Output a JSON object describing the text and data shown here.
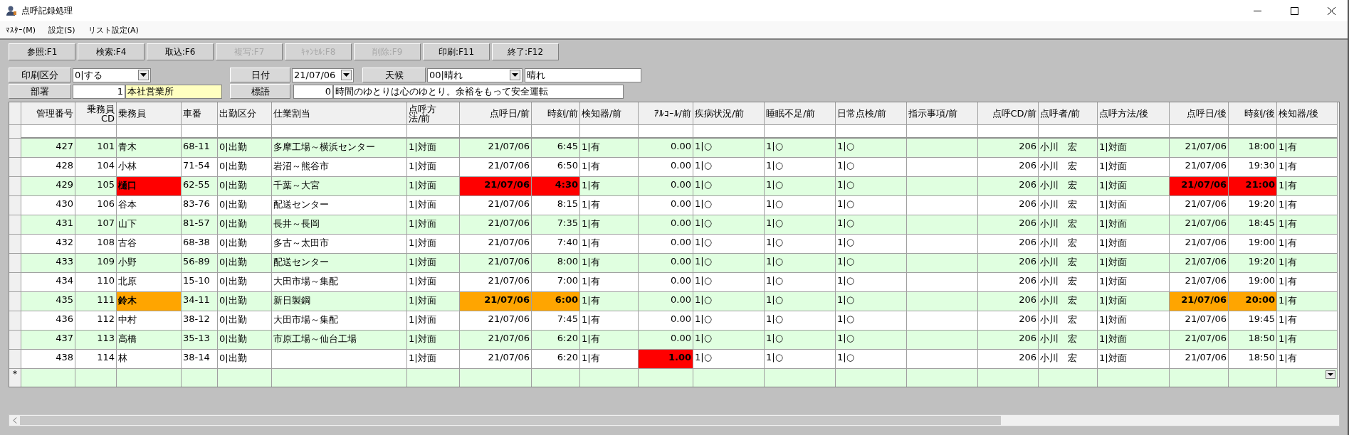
{
  "window": {
    "title": "点呼記録処理"
  },
  "menu": [
    "ﾏｽﾀｰ(M)",
    "設定(S)",
    "リスト設定(A)"
  ],
  "toolbar": [
    {
      "label": "参照:F1",
      "disabled": false
    },
    {
      "label": "検索:F4",
      "disabled": false
    },
    {
      "label": "取込:F6",
      "disabled": false
    },
    {
      "label": "複写:F7",
      "disabled": true
    },
    {
      "label": "ｷｬﾝｾﾙ:F8",
      "disabled": true
    },
    {
      "label": "削除:F9",
      "disabled": true
    },
    {
      "label": "印刷:F11",
      "disabled": false
    },
    {
      "label": "終了:F12",
      "disabled": false
    }
  ],
  "form": {
    "print_label": "印刷区分",
    "print_value": "0|する",
    "date_label": "日付",
    "date_value": "21/07/06",
    "weather_label": "天候",
    "weather_value": "00|晴れ",
    "weather_text": "晴れ",
    "dept_label": "部署",
    "dept_code": "1",
    "dept_name": "本社営業所",
    "motto_label": "標語",
    "motto_code": "0",
    "motto_text": "時間のゆとりは心のゆとり。余裕をもって安全運転"
  },
  "table": {
    "columns": [
      {
        "label": "管理番号",
        "kind": "num"
      },
      {
        "label": "乗務員CD",
        "kind": "num"
      },
      {
        "label": "乗務員",
        "kind": "text"
      },
      {
        "label": "車番",
        "kind": "text"
      },
      {
        "label": "出勤区分",
        "kind": "text"
      },
      {
        "label": "仕業割当",
        "kind": "text"
      },
      {
        "label": "点呼方法/前",
        "kind": "text"
      },
      {
        "label": "点呼日/前",
        "kind": "num"
      },
      {
        "label": "時刻/前",
        "kind": "num"
      },
      {
        "label": "検知器/前",
        "kind": "text"
      },
      {
        "label": "ｱﾙｺｰﾙ/前",
        "kind": "num"
      },
      {
        "label": "疾病状況/前",
        "kind": "text"
      },
      {
        "label": "睡眠不足/前",
        "kind": "text"
      },
      {
        "label": "日常点検/前",
        "kind": "text"
      },
      {
        "label": "指示事項/前",
        "kind": "text"
      },
      {
        "label": "点呼CD/前",
        "kind": "num"
      },
      {
        "label": "点呼者/前",
        "kind": "text"
      },
      {
        "label": "点呼方法/後",
        "kind": "text"
      },
      {
        "label": "点呼日/後",
        "kind": "num"
      },
      {
        "label": "時刻/後",
        "kind": "num"
      },
      {
        "label": "検知器/後",
        "kind": "text"
      }
    ],
    "rows": [
      [
        "427",
        "101",
        "青木",
        "68-11",
        "0|出勤",
        "多摩工場～横浜センター",
        "1|対面",
        "21/07/06",
        "6:45",
        "1|有",
        "0.00",
        "1|○",
        "1|○",
        "1|○",
        null,
        "206",
        "小川　宏",
        "1|対面",
        "21/07/06",
        "18:00",
        "1|有"
      ],
      [
        "428",
        "104",
        "小林",
        "71-54",
        "0|出勤",
        "岩沼～熊谷市",
        "1|対面",
        "21/07/06",
        "6:50",
        "1|有",
        "0.00",
        "1|○",
        "1|○",
        "1|○",
        null,
        "206",
        "小川　宏",
        "1|対面",
        "21/07/06",
        "19:30",
        "1|有"
      ],
      [
        "429",
        "105",
        {
          "text": "樋口",
          "color": "#ff0000"
        },
        "62-55",
        "0|出勤",
        "千葉～大宮",
        "1|対面",
        {
          "text": "21/07/06",
          "color": "#ff0000"
        },
        {
          "text": "4:30",
          "color": "#ff0000"
        },
        "1|有",
        "0.00",
        "1|○",
        "1|○",
        "1|○",
        null,
        "206",
        "小川　宏",
        "1|対面",
        {
          "text": "21/07/06",
          "color": "#ff0000"
        },
        {
          "text": "21:00",
          "color": "#ff0000"
        },
        "1|有"
      ],
      [
        "430",
        "106",
        "谷本",
        "83-76",
        "0|出勤",
        "配送センター",
        "1|対面",
        "21/07/06",
        "8:15",
        "1|有",
        "0.00",
        "1|○",
        "1|○",
        "1|○",
        null,
        "206",
        "小川　宏",
        "1|対面",
        "21/07/06",
        "19:20",
        "1|有"
      ],
      [
        "431",
        "107",
        "山下",
        "81-57",
        "0|出勤",
        "長井～長岡",
        "1|対面",
        "21/07/06",
        "7:35",
        "1|有",
        "0.00",
        "1|○",
        "1|○",
        "1|○",
        null,
        "206",
        "小川　宏",
        "1|対面",
        "21/07/06",
        "18:45",
        "1|有"
      ],
      [
        "432",
        "108",
        "古谷",
        "68-38",
        "0|出勤",
        "多古～太田市",
        "1|対面",
        "21/07/06",
        "7:40",
        "1|有",
        "0.00",
        "1|○",
        "1|○",
        "1|○",
        null,
        "206",
        "小川　宏",
        "1|対面",
        "21/07/06",
        "19:00",
        "1|有"
      ],
      [
        "433",
        "109",
        "小野",
        "56-89",
        "0|出勤",
        "配送センター",
        "1|対面",
        "21/07/06",
        "8:00",
        "1|有",
        "0.00",
        "1|○",
        "1|○",
        "1|○",
        null,
        "206",
        "小川　宏",
        "1|対面",
        "21/07/06",
        "19:20",
        "1|有"
      ],
      [
        "434",
        "110",
        "北原",
        "15-10",
        "0|出勤",
        "大田市場～集配",
        "1|対面",
        "21/07/06",
        "7:00",
        "1|有",
        "0.00",
        "1|○",
        "1|○",
        "1|○",
        null,
        "206",
        "小川　宏",
        "1|対面",
        "21/07/06",
        "19:00",
        "1|有"
      ],
      [
        "435",
        "111",
        {
          "text": "鈴木",
          "color": "#ffa500"
        },
        "34-11",
        "0|出勤",
        "新日製鋼",
        "1|対面",
        {
          "text": "21/07/06",
          "color": "#ffa500"
        },
        {
          "text": "6:00",
          "color": "#ffa500"
        },
        "1|有",
        "0.00",
        "1|○",
        "1|○",
        "1|○",
        null,
        "206",
        "小川　宏",
        "1|対面",
        {
          "text": "21/07/06",
          "color": "#ffa500"
        },
        {
          "text": "20:00",
          "color": "#ffa500"
        },
        "1|有"
      ],
      [
        "436",
        "112",
        "中村",
        "38-12",
        "0|出勤",
        "大田市場～集配",
        "1|対面",
        "21/07/06",
        "7:45",
        "1|有",
        "0.00",
        "1|○",
        "1|○",
        "1|○",
        null,
        "206",
        "小川　宏",
        "1|対面",
        "21/07/06",
        "19:45",
        "1|有"
      ],
      [
        "437",
        "113",
        "高橋",
        "35-13",
        "0|出勤",
        "市原工場～仙台工場",
        "1|対面",
        "21/07/06",
        "6:20",
        "1|有",
        "0.00",
        "1|○",
        "1|○",
        "1|○",
        null,
        "206",
        "小川　宏",
        "1|対面",
        "21/07/06",
        "18:50",
        "1|有"
      ],
      [
        "438",
        "114",
        "林",
        "38-14",
        "0|出勤",
        null,
        "1|対面",
        "21/07/06",
        "6:20",
        "1|有",
        {
          "text": "1.00",
          "color": "#ff0000"
        },
        "1|○",
        "1|○",
        "1|○",
        null,
        "206",
        "小川　宏",
        "1|対面",
        "21/07/06",
        "18:50",
        "1|有"
      ]
    ],
    "new_row_marker": "*"
  }
}
